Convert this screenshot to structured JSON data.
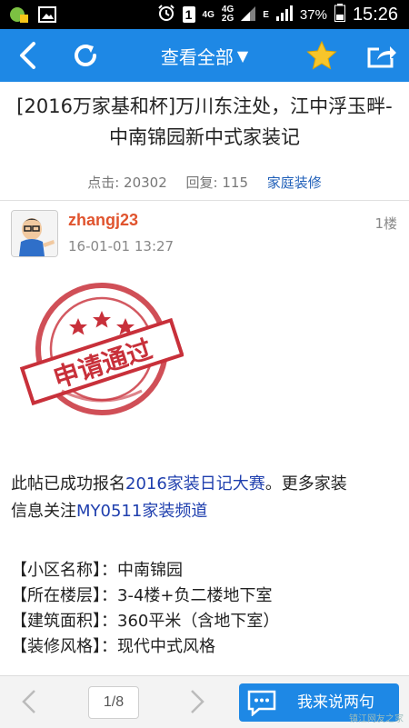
{
  "status_bar": {
    "time": "15:26",
    "battery": "37%",
    "network_1": "4G",
    "network_2": "4G",
    "network_2b": "2G",
    "network_3": "E",
    "sim": "1"
  },
  "header": {
    "title": "查看全部",
    "title_caret": "▼",
    "accent": "#1e88e5"
  },
  "post": {
    "title": "[2016万家基和杯]万川东注处，江中浮玉畔-中南锦园新中式家装记",
    "clicks_label": "点击: 20302",
    "replies_label": "回复: 115",
    "category": "家庭装修"
  },
  "author": {
    "name": "zhangj23",
    "time": "16-01-01 13:27",
    "floor": "1楼"
  },
  "stamp": {
    "text": "申请通过"
  },
  "body": {
    "line1_prefix": "此帖已成功报名",
    "line1_link": "2016家装日记大赛",
    "line1_suffix": "。更多家装",
    "line2_prefix": "信息关注",
    "line2_link": "MY0511家装频道"
  },
  "info_rows": [
    "【小区名称】：中南锦园",
    "【所在楼层】：3-4楼+负二楼地下室",
    "【建筑面积】：360平米（含地下室）",
    "【装修风格】：现代中式风格"
  ],
  "footer": {
    "page": "1/8",
    "reply_label": "我来说两句",
    "watermark": "镇江网友之家"
  }
}
